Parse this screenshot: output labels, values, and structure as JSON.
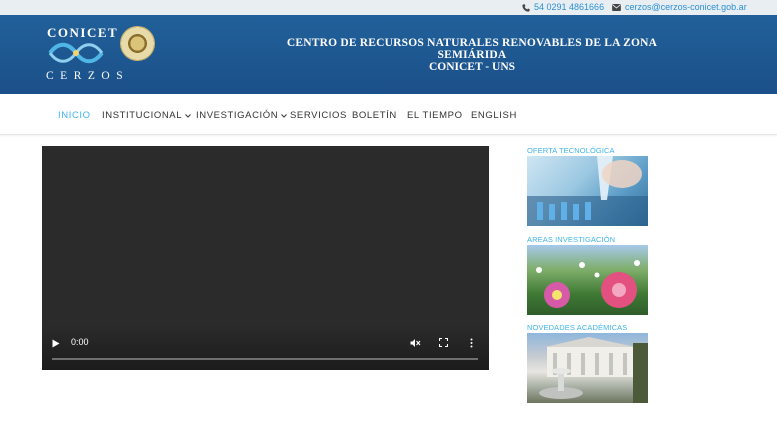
{
  "topbar": {
    "phone": "54 0291 4861666",
    "email": "cerzos@cerzos-conicet.gob.ar",
    "phone_icon": "phone-icon",
    "email_icon": "envelope-icon"
  },
  "header": {
    "logo_top": "CONICET",
    "logo_bottom": "CERZOS",
    "title": "CENTRO DE RECURSOS NATURALES RENOVABLES DE LA ZONA SEMIÁRIDA",
    "subtitle": "CONICET - UNS"
  },
  "nav": {
    "items": [
      {
        "label": "INICIO",
        "active": true
      },
      {
        "label": "INSTITUCIONAL",
        "dropdown": true
      },
      {
        "label": "INVESTIGACIÓN",
        "dropdown": true
      },
      {
        "label": "SERVICIOS"
      },
      {
        "label": "BOLETÍN"
      },
      {
        "label": "EL TIEMPO"
      },
      {
        "label": "ENGLISH"
      }
    ]
  },
  "video": {
    "time": "0:00",
    "progress": 0
  },
  "sidebar": {
    "items": [
      {
        "title": "OFERTA TECNOLÓGICA"
      },
      {
        "title": "AREAS INVESTIGACIÓN"
      },
      {
        "title": "NOVEDADES ACADÉMICAS"
      }
    ]
  },
  "colors": {
    "header_bg": "#1f5991",
    "accent": "#3fb5e8",
    "topbar_bg": "#e9eef3",
    "video_bg": "#2b2b2b"
  }
}
